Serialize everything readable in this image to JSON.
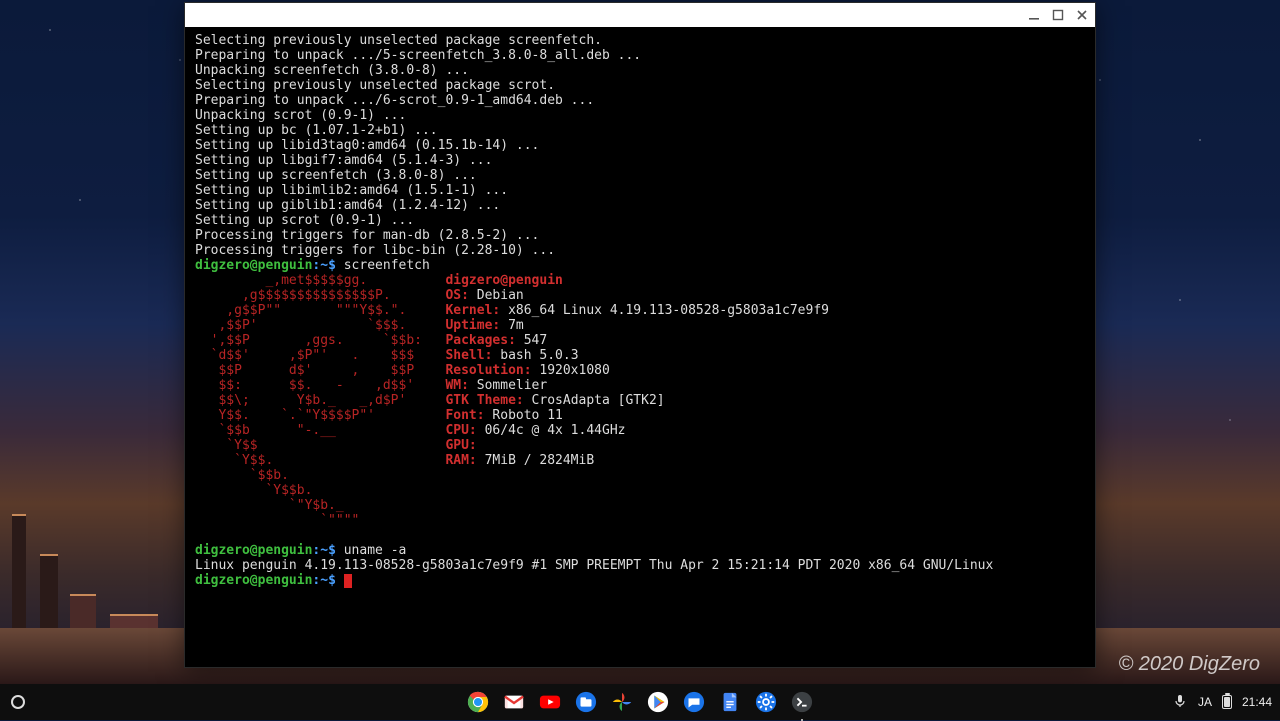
{
  "watermark": "© 2020 DigZero",
  "window": {
    "controls": {
      "minimize": "_",
      "maximize": "▢",
      "close": "✕"
    }
  },
  "terminal": {
    "apt": [
      "Selecting previously unselected package screenfetch.",
      "Preparing to unpack .../5-screenfetch_3.8.0-8_all.deb ...",
      "Unpacking screenfetch (3.8.0-8) ...",
      "Selecting previously unselected package scrot.",
      "Preparing to unpack .../6-scrot_0.9-1_amd64.deb ...",
      "Unpacking scrot (0.9-1) ...",
      "Setting up bc (1.07.1-2+b1) ...",
      "Setting up libid3tag0:amd64 (0.15.1b-14) ...",
      "Setting up libgif7:amd64 (5.1.4-3) ...",
      "Setting up screenfetch (3.8.0-8) ...",
      "Setting up libimlib2:amd64 (1.5.1-1) ...",
      "Setting up giblib1:amd64 (1.2.4-12) ...",
      "Setting up scrot (0.9-1) ...",
      "Processing triggers for man-db (2.8.5-2) ...",
      "Processing triggers for libc-bin (2.28-10) ..."
    ],
    "prompt": {
      "user": "digzero",
      "at": "@",
      "host": "penguin",
      "path": ":~$ "
    },
    "cmd1": "screenfetch",
    "ascii": [
      "         _,met$$$$$gg.          ",
      "      ,g$$$$$$$$$$$$$$$P.       ",
      "    ,g$$P\"\"       \"\"\"Y$$.\".     ",
      "   ,$$P'              `$$$.     ",
      "  ',$$P       ,ggs.     `$$b:   ",
      "  `d$$'     ,$P\"'   .    $$$    ",
      "   $$P      d$'     ,    $$P    ",
      "   $$:      $$.   -    ,d$$'    ",
      "   $$\\;      Y$b._   _,d$P'     ",
      "   Y$$.    `.`\"Y$$$$P\"'         ",
      "   `$$b      \"-.__              ",
      "    `Y$$                        ",
      "     `Y$$.                      ",
      "       `$$b.                    ",
      "         `Y$$b.                 ",
      "            `\"Y$b._             ",
      "                `\"\"\"\"           "
    ],
    "info": {
      "userline_user": "digzero",
      "userline_at": "@",
      "userline_host": "penguin",
      "OS": {
        "label": "OS:",
        "value": " Debian"
      },
      "Kernel": {
        "label": "Kernel:",
        "value": " x86_64 Linux 4.19.113-08528-g5803a1c7e9f9"
      },
      "Uptime": {
        "label": "Uptime:",
        "value": " 7m"
      },
      "Packages": {
        "label": "Packages:",
        "value": " 547"
      },
      "Shell": {
        "label": "Shell:",
        "value": " bash 5.0.3"
      },
      "Resolution": {
        "label": "Resolution:",
        "value": " 1920x1080"
      },
      "WM": {
        "label": "WM:",
        "value": " Sommelier"
      },
      "GTK": {
        "label": "GTK Theme:",
        "value": " CrosAdapta [GTK2]"
      },
      "Font": {
        "label": "Font:",
        "value": " Roboto 11"
      },
      "CPU": {
        "label": "CPU:",
        "value": " 06/4c @ 4x 1.44GHz"
      },
      "GPU": {
        "label": "GPU:",
        "value": " "
      },
      "RAM": {
        "label": "RAM:",
        "value": " 7MiB / 2824MiB"
      }
    },
    "cmd2": "uname -a",
    "uname_out": "Linux penguin 4.19.113-08528-g5803a1c7e9f9 #1 SMP PREEMPT Thu Apr 2 15:21:14 PDT 2020 x86_64 GNU/Linux"
  },
  "shelf": {
    "lang": "JA",
    "clock": "21:44",
    "apps": [
      "chrome",
      "gmail",
      "youtube",
      "files",
      "photos",
      "play",
      "messages",
      "docs",
      "settings",
      "terminal"
    ]
  }
}
